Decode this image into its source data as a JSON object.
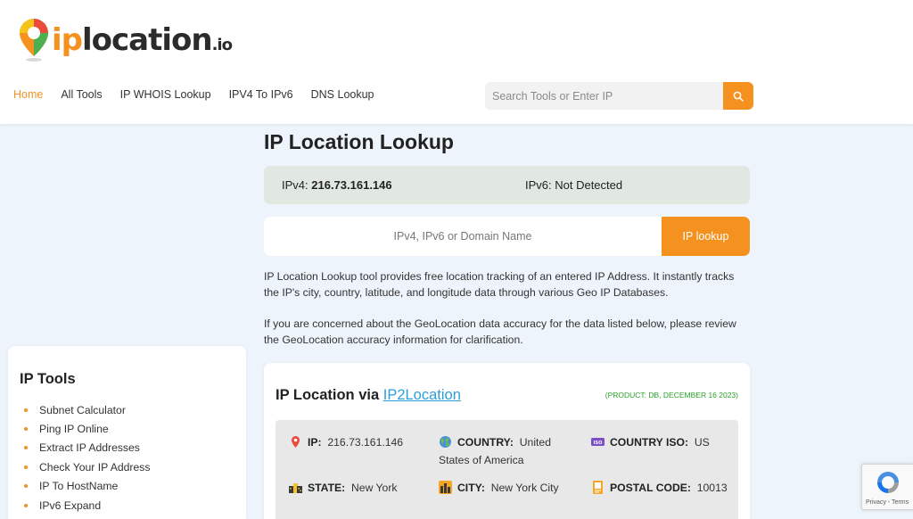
{
  "logo": {
    "prefix": "ip",
    "main": "location",
    "suffix": ".io"
  },
  "nav": [
    {
      "label": "Home",
      "active": true
    },
    {
      "label": "All Tools",
      "active": false
    },
    {
      "label": "IP WHOIS Lookup",
      "active": false
    },
    {
      "label": "IPV4 To IPv6",
      "active": false
    },
    {
      "label": "DNS Lookup",
      "active": false
    }
  ],
  "search": {
    "placeholder": "Search Tools or Enter IP",
    "icon": "search-icon"
  },
  "main": {
    "title": "IP Location Lookup",
    "ipv4_label": "IPv4:",
    "ipv4_value": "216.73.161.146",
    "ipv6_text": "IPv6: Not Detected",
    "lookup_placeholder": "IPv4, IPv6 or Domain Name",
    "lookup_button": "IP lookup",
    "para1": "IP Location Lookup tool provides free location tracking of an entered IP Address. It instantly tracks the IP's city, country, latitude, and longitude data through various Geo IP Databases.",
    "para2": "If you are concerned about the GeoLocation data accuracy for the data listed below, please review the GeoLocation accuracy information for clarification."
  },
  "sidebar": {
    "title": "IP Tools",
    "items": [
      "Subnet Calculator",
      "Ping IP Online",
      "Extract IP Addresses",
      "Check Your IP Address",
      "IP To HostName",
      "IPv6 Expand"
    ]
  },
  "card": {
    "title_prefix": "IP Location via ",
    "title_link": "IP2Location",
    "product": "(PRODUCT: DB, DECEMBER 16 2023)",
    "fields": {
      "ip": {
        "label": "IP:",
        "value": "216.73.161.146"
      },
      "country": {
        "label": "COUNTRY:",
        "value_line1": "United",
        "value_line2": "States of America"
      },
      "country_iso": {
        "label": "COUNTRY ISO:",
        "value": "US"
      },
      "state": {
        "label": "STATE:",
        "value": "New York"
      },
      "city": {
        "label": "CITY:",
        "value": "New York City"
      },
      "postal": {
        "label": "POSTAL CODE:",
        "value": "10013"
      }
    }
  },
  "recaptcha": {
    "terms": "Privacy - Terms"
  },
  "colors": {
    "accent": "#f5911e",
    "link": "#2a9fd8",
    "product_green": "#2aa02a"
  }
}
